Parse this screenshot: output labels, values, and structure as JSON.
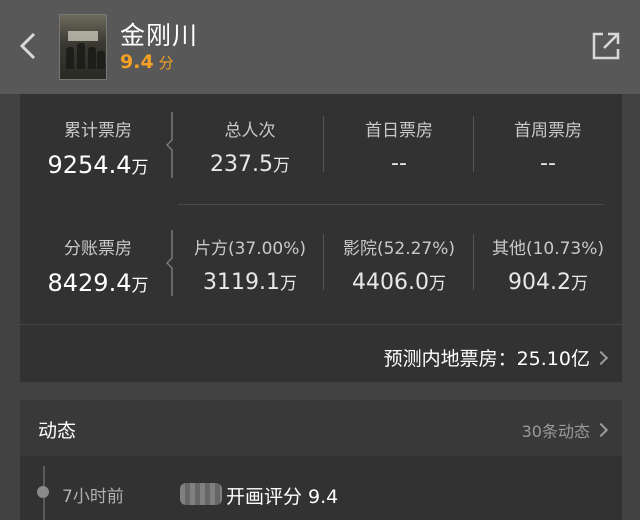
{
  "header": {
    "title": "金刚川",
    "rating": "9.4",
    "rating_unit": "分"
  },
  "box_office": {
    "row1": {
      "main_label": "累计票房",
      "main_value": "9254.4",
      "main_unit": "万",
      "cells": [
        {
          "label": "总人次",
          "value": "237.5",
          "unit": "万"
        },
        {
          "label": "首日票房",
          "value": "--",
          "unit": ""
        },
        {
          "label": "首周票房",
          "value": "--",
          "unit": ""
        }
      ]
    },
    "row2": {
      "main_label": "分账票房",
      "main_value": "8429.4",
      "main_unit": "万",
      "cells": [
        {
          "label": "片方(37.00%)",
          "value": "3119.1",
          "unit": "万"
        },
        {
          "label": "影院(52.27%)",
          "value": "4406.0",
          "unit": "万"
        },
        {
          "label": "其他(10.73%)",
          "value": "904.2",
          "unit": "万"
        }
      ]
    },
    "predict": "预测内地票房：25.10亿"
  },
  "dynamics": {
    "title": "动态",
    "more": "30条动态",
    "items": [
      {
        "time": "7小时前",
        "text": "开画评分 9.4"
      }
    ]
  }
}
